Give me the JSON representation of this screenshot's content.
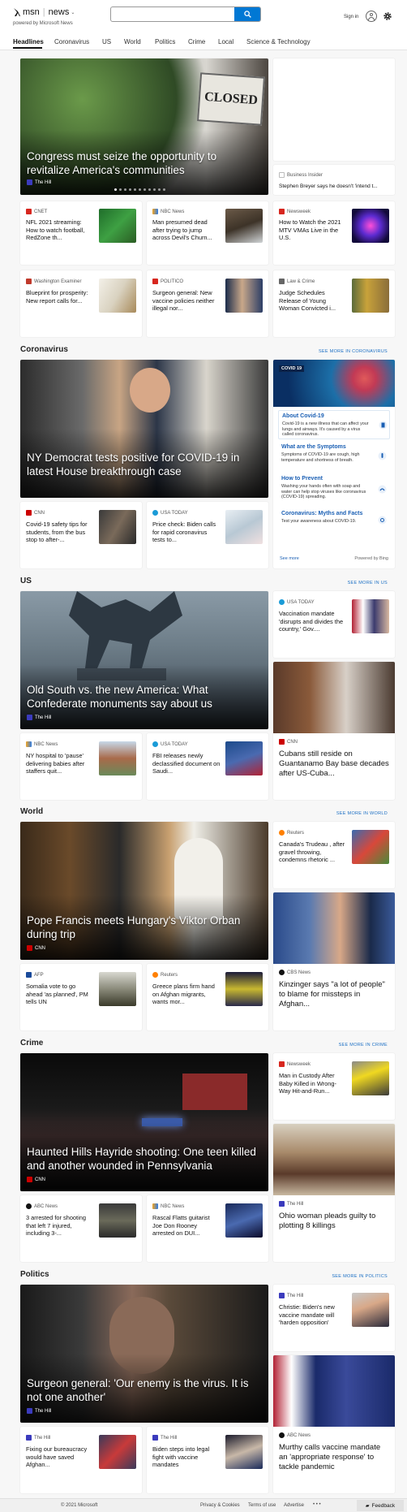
{
  "header": {
    "brand": "msn",
    "brand_sep": "news",
    "powered": "powered by Microsoft News",
    "signin": "Sign in",
    "search_placeholder": ""
  },
  "nav": [
    "Headlines",
    "Coronavirus",
    "US",
    "World",
    "Politics",
    "Crime",
    "Local",
    "Science & Technology"
  ],
  "colors": {
    "accent": "#0078d4",
    "bg": "#f7f7f7"
  },
  "hero1": {
    "title": "Congress must seize the opportunity to revitalize America's communities",
    "source": "The Hill",
    "sign": "CLOSED"
  },
  "side1": {
    "source": "Business Insider",
    "title": "Stephen Breyer says he doesn't 'intend t..."
  },
  "row1": [
    {
      "source": "CNET",
      "title": "NFL 2021 streaming: How to watch football, RedZone th..."
    },
    {
      "source": "NBC News",
      "title": "Man presumed dead after trying to jump across Devil's Churn..."
    },
    {
      "source": "Newsweek",
      "title": "How to Watch the 2021 MTV VMAs Live in the U.S."
    }
  ],
  "row2": [
    {
      "source": "Washington Examiner",
      "title": "Blueprint for prosperity: New report calls for..."
    },
    {
      "source": "POLITICO",
      "title": "Surgeon general: New vaccine policies neither illegal nor..."
    },
    {
      "source": "Law & Crime",
      "title": "Judge Schedules Release of Young Woman Convicted i..."
    }
  ],
  "coronavirus": {
    "title": "Coronavirus",
    "see_more": "SEE MORE IN CORONAVIRUS",
    "hero": {
      "title": "NY Democrat tests positive for COVID-19 in latest House breakthrough case"
    },
    "cards": [
      {
        "source": "CNN",
        "title": "Covid-19 safety tips for students, from the bus stop to after-..."
      },
      {
        "source": "USA TODAY",
        "title": "Price check: Biden calls for rapid coronavirus tests to..."
      }
    ],
    "info": {
      "badge": "COVID 19",
      "items": [
        {
          "h": "About Covid-19",
          "t": "Covid-19 is a new illness that can affect your lungs and airways. It's caused by a virus called coronavirus."
        },
        {
          "h": "What are the Symptoms",
          "t": "Symptoms of COVID-19 are cough, high temperature and shortness of breath."
        },
        {
          "h": "How to Prevent",
          "t": "Washing your hands often with soap and water can help stop viruses like coronavirus (COVID-19) spreading."
        },
        {
          "h": "Coronavirus: Myths and Facts",
          "t": "Test your awareness about COVID-19."
        }
      ],
      "see_more": "See more",
      "powered": "Powered by Bing"
    }
  },
  "us": {
    "title": "US",
    "see_more": "SEE MORE IN US",
    "hero": {
      "title": "Old South vs. the new America: What Confederate monuments say about us",
      "source": "The Hill"
    },
    "side": {
      "source": "USA TODAY",
      "title": "Vaccination mandate 'disrupts and divides the country,' Gov...."
    },
    "cards": [
      {
        "source": "NBC News",
        "title": "NY hospital to 'pause' delivering babies after staffers quit..."
      },
      {
        "source": "USA TODAY",
        "title": "FBI releases newly declassified document on Saudi..."
      }
    ],
    "tall": {
      "source": "CNN",
      "title": "Cubans still reside on Guantanamo Bay base decades after US-Cuba..."
    }
  },
  "world": {
    "title": "World",
    "see_more": "SEE MORE IN WORLD",
    "hero": {
      "title": "Pope Francis meets Hungary's Viktor Orban during trip",
      "source": "CNN"
    },
    "side": {
      "source": "Reuters",
      "title": "Canada's Trudeau , after gravel throwing, condemns rhetoric ..."
    },
    "cards": [
      {
        "source": "AFP",
        "title": "Somalia vote to go ahead 'as planned', PM tells UN"
      },
      {
        "source": "Reuters",
        "title": "Greece plans firm hand on Afghan migrants, wants mor..."
      }
    ],
    "tall": {
      "source": "CBS News",
      "title": "Kinzinger says \"a lot of people\" to blame for missteps in Afghan..."
    }
  },
  "crime": {
    "title": "Crime",
    "see_more": "SEE MORE IN CRIME",
    "hero": {
      "title": "Haunted Hills Hayride shooting: One teen killed and another wounded in Pennsylvania",
      "source": "CNN"
    },
    "side": {
      "source": "Newsweek",
      "title": "Man in Custody After Baby Killed in Wrong-Way Hit-and-Run..."
    },
    "cards": [
      {
        "source": "ABC News",
        "title": "3 arrested for shooting that left 7 injured, including 3-..."
      },
      {
        "source": "NBC News",
        "title": "Rascal Flatts guitarist Joe Don Rooney arrested on DUI..."
      }
    ],
    "tall": {
      "source": "The Hill",
      "title": "Ohio woman pleads guilty to plotting 8 killings"
    }
  },
  "politics": {
    "title": "Politics",
    "see_more": "SEE MORE IN POLITICS",
    "hero": {
      "title": "Surgeon general: 'Our enemy is the virus. It is not one another'",
      "source": "The Hill"
    },
    "side": {
      "source": "The Hill",
      "title": "Christie: Biden's new vaccine mandate will 'harden opposition'"
    },
    "cards": [
      {
        "source": "The Hill",
        "title": "Fixing our bureaucracy would have saved Afghan..."
      },
      {
        "source": "The Hill",
        "title": "Biden steps into legal fight with vaccine mandates"
      }
    ],
    "tall": {
      "source": "ABC News",
      "title": "Murthy calls vaccine mandate an 'appropriate response' to tackle pandemic"
    }
  },
  "footer": {
    "copyright": "© 2021 Microsoft",
    "links": [
      "Privacy & Cookies",
      "Terms of use",
      "Advertise"
    ],
    "more": "• • •",
    "feedback": "Feedback"
  }
}
